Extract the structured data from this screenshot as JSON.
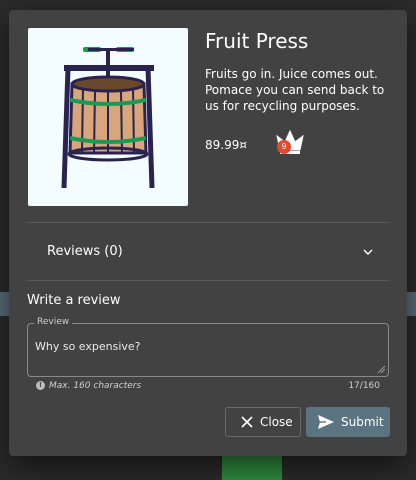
{
  "product": {
    "title": "Fruit Press",
    "description": "Fruits go in. Juice comes out. Pomace you can send back to us for recycling purposes.",
    "price": "89.99¤",
    "badge_count": "9",
    "image_icon": "fruit-press-image",
    "crown_icon": "crown-icon"
  },
  "reviews": {
    "label": "Reviews (0)"
  },
  "write_review": {
    "heading": "Write a review",
    "field_label": "Review",
    "value": "Why so expensive?",
    "hint": "Max. 160 characters",
    "count": "17/160"
  },
  "actions": {
    "close_label": "Close",
    "submit_label": "Submit"
  },
  "colors": {
    "dialog_bg": "#424242",
    "submit_bg": "#5b7482",
    "badge": "#e24a2e"
  }
}
